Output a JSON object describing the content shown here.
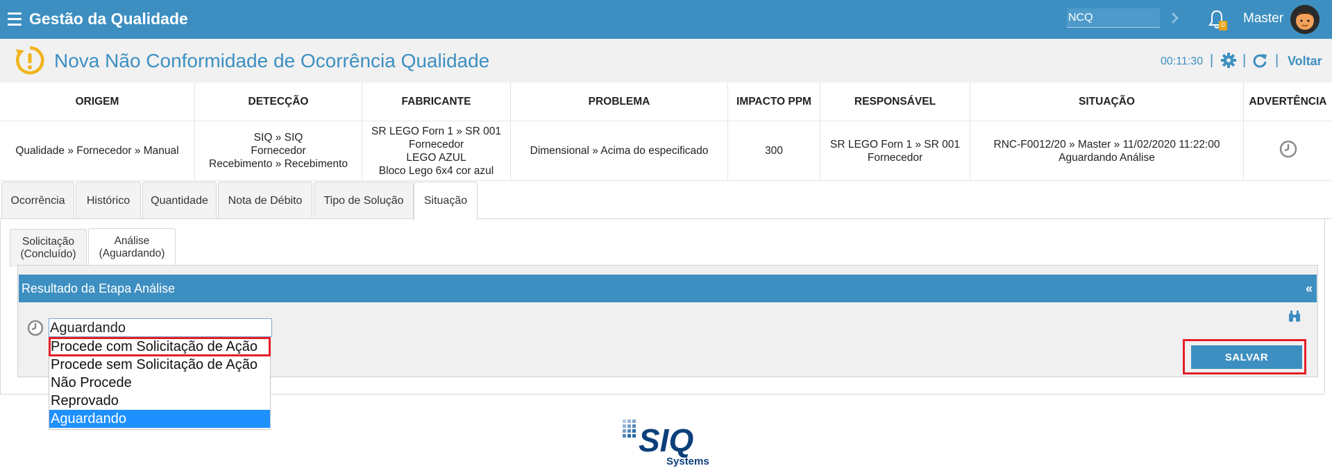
{
  "app": {
    "title": "Gestão da Qualidade"
  },
  "topbar": {
    "search_value": "NCQ",
    "notification_count": "0",
    "user_name": "Master"
  },
  "page": {
    "title": "Nova Não Conformidade de Ocorrência Qualidade",
    "timer": "00:11:30",
    "back_label": "Voltar"
  },
  "info_table": {
    "headers": [
      "ORIGEM",
      "DETECÇÃO",
      "FABRICANTE",
      "PROBLEMA",
      "IMPACTO PPM",
      "RESPONSÁVEL",
      "SITUAÇÃO",
      "ADVERTÊNCIA"
    ],
    "row": {
      "origem": [
        "Qualidade » Fornecedor » Manual"
      ],
      "deteccao": [
        "SIQ » SIQ",
        "Fornecedor",
        "Recebimento » Recebimento"
      ],
      "fabricante": [
        "SR LEGO Forn 1 » SR 001",
        "Fornecedor",
        "LEGO AZUL",
        "Bloco Lego 6x4 cor azul"
      ],
      "problema": [
        "Dimensional » Acima do especificado"
      ],
      "impacto": [
        "300"
      ],
      "responsavel": [
        "SR LEGO Forn 1 » SR 001",
        "Fornecedor"
      ],
      "situacao": [
        "RNC-F0012/20 » Master » 11/02/2020 11:22:00",
        "Aguardando Análise"
      ],
      "advertencia_icon": "clock-icon"
    }
  },
  "tabs": [
    "Ocorrência",
    "Histórico",
    "Quantidade",
    "Nota de Débito",
    "Tipo de Solução",
    "Situação"
  ],
  "active_tab": "Situação",
  "subtabs": [
    {
      "line1": "Solicitação",
      "line2": "(Concluído)"
    },
    {
      "line1": "Análise",
      "line2": "(Aguardando)"
    }
  ],
  "panel": {
    "title": "Resultado da Etapa Análise",
    "collapse_label": "«",
    "select_value": "Aguardando",
    "options": [
      "Procede com Solicitação de Ação",
      "Procede sem Solicitação de Ação",
      "Não Procede",
      "Reprovado",
      "Aguardando"
    ],
    "highlighted_option": "Procede com Solicitação de Ação",
    "selected_option": "Aguardando",
    "save_label": "SALVAR"
  },
  "footer": {
    "logo_text": "SIQ",
    "logo_subtext": "Systems"
  },
  "colors": {
    "primary": "#3d8fc1",
    "accent": "#f0b41c",
    "highlight": "#e41e26",
    "selected": "#1e90ff"
  }
}
